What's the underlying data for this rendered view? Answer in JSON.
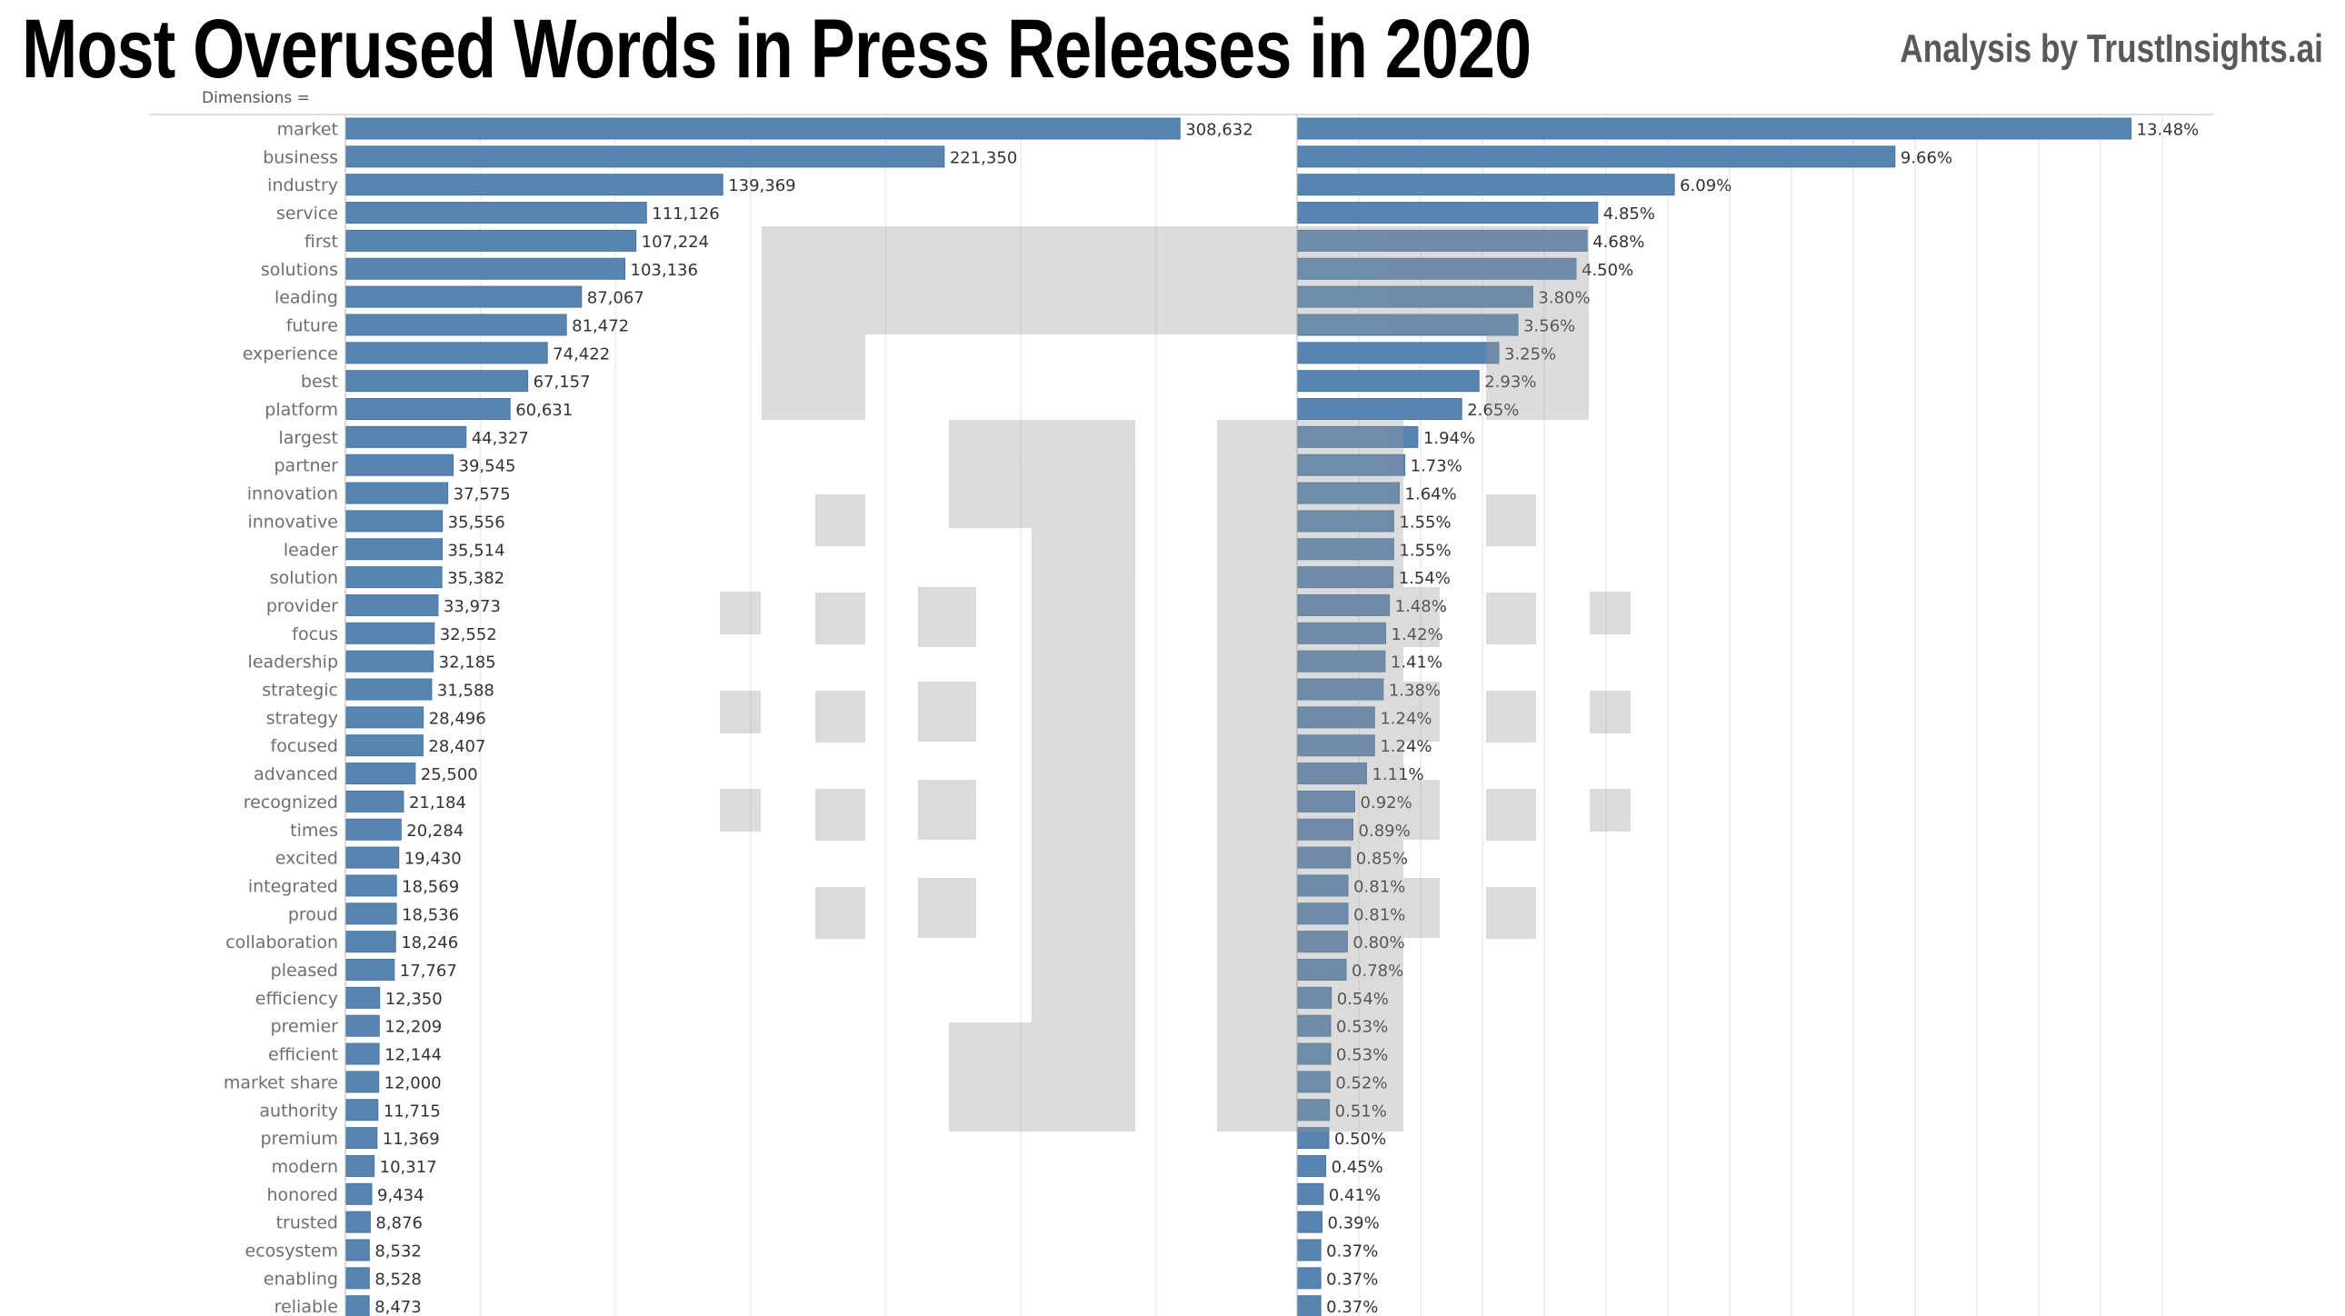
{
  "header": {
    "title": "Most Overused Words in Press Releases in 2020",
    "credit": "Analysis by TrustInsights.ai",
    "dimensions_label": "Dimensions ="
  },
  "colors": {
    "bar": "#5884b0",
    "grid": "#efefef",
    "axis": "#d9d9d9",
    "watermark": "#e2e2e2"
  },
  "chart_data": [
    {
      "type": "bar",
      "orientation": "horizontal",
      "title": "",
      "xlabel": "",
      "ylabel": "",
      "grid": true,
      "xlim": [
        0,
        310000
      ],
      "categories": [
        "market",
        "business",
        "industry",
        "service",
        "first",
        "solutions",
        "leading",
        "future",
        "experience",
        "best",
        "platform",
        "largest",
        "partner",
        "innovation",
        "innovative",
        "leader",
        "solution",
        "provider",
        "focus",
        "leadership",
        "strategic",
        "strategy",
        "focused",
        "advanced",
        "recognized",
        "times",
        "excited",
        "integrated",
        "proud",
        "collaboration",
        "pleased",
        "efficiency",
        "premier",
        "efficient",
        "market share",
        "authority",
        "premium",
        "modern",
        "honored",
        "trusted",
        "ecosystem",
        "enabling",
        "reliable"
      ],
      "values": [
        308632,
        221350,
        139369,
        111126,
        107224,
        103136,
        87067,
        81472,
        74422,
        67157,
        60631,
        44327,
        39545,
        37575,
        35556,
        35514,
        35382,
        33973,
        32552,
        32185,
        31588,
        28496,
        28407,
        25500,
        21184,
        20284,
        19430,
        18569,
        18536,
        18246,
        17767,
        12350,
        12209,
        12144,
        12000,
        11715,
        11369,
        10317,
        9434,
        8876,
        8532,
        8528,
        8473
      ],
      "labels": [
        "308,632",
        "221,350",
        "139,369",
        "111,126",
        "107,224",
        "103,136",
        "87,067",
        "81,472",
        "74,422",
        "67,157",
        "60,631",
        "44,327",
        "39,545",
        "37,575",
        "35,556",
        "35,514",
        "35,382",
        "33,973",
        "32,552",
        "32,185",
        "31,588",
        "28,496",
        "28,407",
        "25,500",
        "21,184",
        "20,284",
        "19,430",
        "18,569",
        "18,536",
        "18,246",
        "17,767",
        "12,350",
        "12,209",
        "12,144",
        "12,000",
        "11,715",
        "11,369",
        "10,317",
        "9,434",
        "8,876",
        "8,532",
        "8,528",
        "8,473"
      ]
    },
    {
      "type": "bar",
      "orientation": "horizontal",
      "title": "",
      "xlabel": "",
      "ylabel": "",
      "grid": true,
      "xlim": [
        0,
        13.6
      ],
      "categories": [
        "market",
        "business",
        "industry",
        "service",
        "first",
        "solutions",
        "leading",
        "future",
        "experience",
        "best",
        "platform",
        "largest",
        "partner",
        "innovation",
        "innovative",
        "leader",
        "solution",
        "provider",
        "focus",
        "leadership",
        "strategic",
        "strategy",
        "focused",
        "advanced",
        "recognized",
        "times",
        "excited",
        "integrated",
        "proud",
        "collaboration",
        "pleased",
        "efficiency",
        "premier",
        "efficient",
        "market share",
        "authority",
        "premium",
        "modern",
        "honored",
        "trusted",
        "ecosystem",
        "enabling",
        "reliable"
      ],
      "values": [
        13.48,
        9.66,
        6.09,
        4.85,
        4.68,
        4.5,
        3.8,
        3.56,
        3.25,
        2.93,
        2.65,
        1.94,
        1.73,
        1.64,
        1.55,
        1.55,
        1.54,
        1.48,
        1.42,
        1.41,
        1.38,
        1.24,
        1.24,
        1.11,
        0.92,
        0.89,
        0.85,
        0.81,
        0.81,
        0.8,
        0.78,
        0.54,
        0.53,
        0.53,
        0.52,
        0.51,
        0.5,
        0.45,
        0.41,
        0.39,
        0.37,
        0.37,
        0.37
      ],
      "labels": [
        "13.48%",
        "9.66%",
        "6.09%",
        "4.85%",
        "4.68%",
        "4.50%",
        "3.80%",
        "3.56%",
        "3.25%",
        "2.93%",
        "2.65%",
        "1.94%",
        "1.73%",
        "1.64%",
        "1.55%",
        "1.55%",
        "1.54%",
        "1.48%",
        "1.42%",
        "1.41%",
        "1.38%",
        "1.24%",
        "1.24%",
        "1.11%",
        "0.92%",
        "0.89%",
        "0.85%",
        "0.81%",
        "0.81%",
        "0.80%",
        "0.78%",
        "0.54%",
        "0.53%",
        "0.53%",
        "0.52%",
        "0.51%",
        "0.50%",
        "0.45%",
        "0.41%",
        "0.39%",
        "0.37%",
        "0.37%",
        "0.37%"
      ],
      "unit": "percent"
    }
  ],
  "watermark": {
    "name": "TrustInsights logo",
    "opacity": 0.35
  }
}
